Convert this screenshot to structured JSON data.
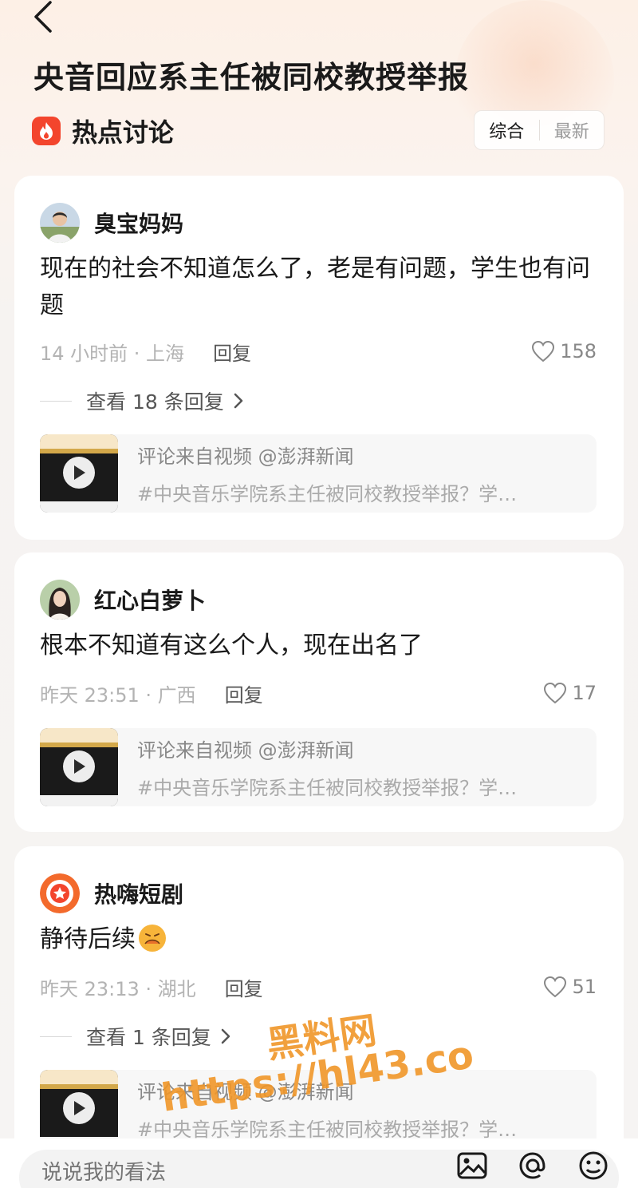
{
  "header": {
    "title": "央音回应系主任被同校教授举报",
    "section_title": "热点讨论",
    "sort_options": [
      "综合",
      "最新"
    ],
    "sort_active": "综合"
  },
  "comments": [
    {
      "author": "臭宝妈妈",
      "content": "现在的社会不知道怎么了，老是有问题，学生也有问题",
      "time": "14 小时前",
      "location": "上海",
      "meta": "14 小时前 · 上海",
      "reply_label": "回复",
      "likes": "158",
      "view_replies": "查看 18 条回复",
      "source_line1": "评论来自视频 @澎湃新闻",
      "source_line2": "#中央音乐学院系主任被同校教授举报？学…"
    },
    {
      "author": "红心白萝卜",
      "content": "根本不知道有这么个人，现在出名了",
      "time": "昨天 23:51",
      "location": "广西",
      "meta": "昨天 23:51 · 广西",
      "reply_label": "回复",
      "likes": "17",
      "source_line1": "评论来自视频 @澎湃新闻",
      "source_line2": "#中央音乐学院系主任被同校教授举报？学…"
    },
    {
      "author": "热嗨短剧",
      "content": "静待后续",
      "emoji": "grimacing-face",
      "time": "昨天 23:13",
      "location": "湖北",
      "meta": "昨天 23:13 · 湖北",
      "reply_label": "回复",
      "likes": "51",
      "view_replies": "查看 1 条回复",
      "source_line1": "评论来自视频 @澎湃新闻",
      "source_line2": "#中央音乐学院系主任被同校教授举报？学…"
    }
  ],
  "watermark": {
    "line1": "黑料网",
    "line2": "https://hl43.co"
  },
  "input": {
    "placeholder": "说说我的看法"
  },
  "colors": {
    "accent": "#f3452d",
    "watermark": "#f0962a"
  }
}
